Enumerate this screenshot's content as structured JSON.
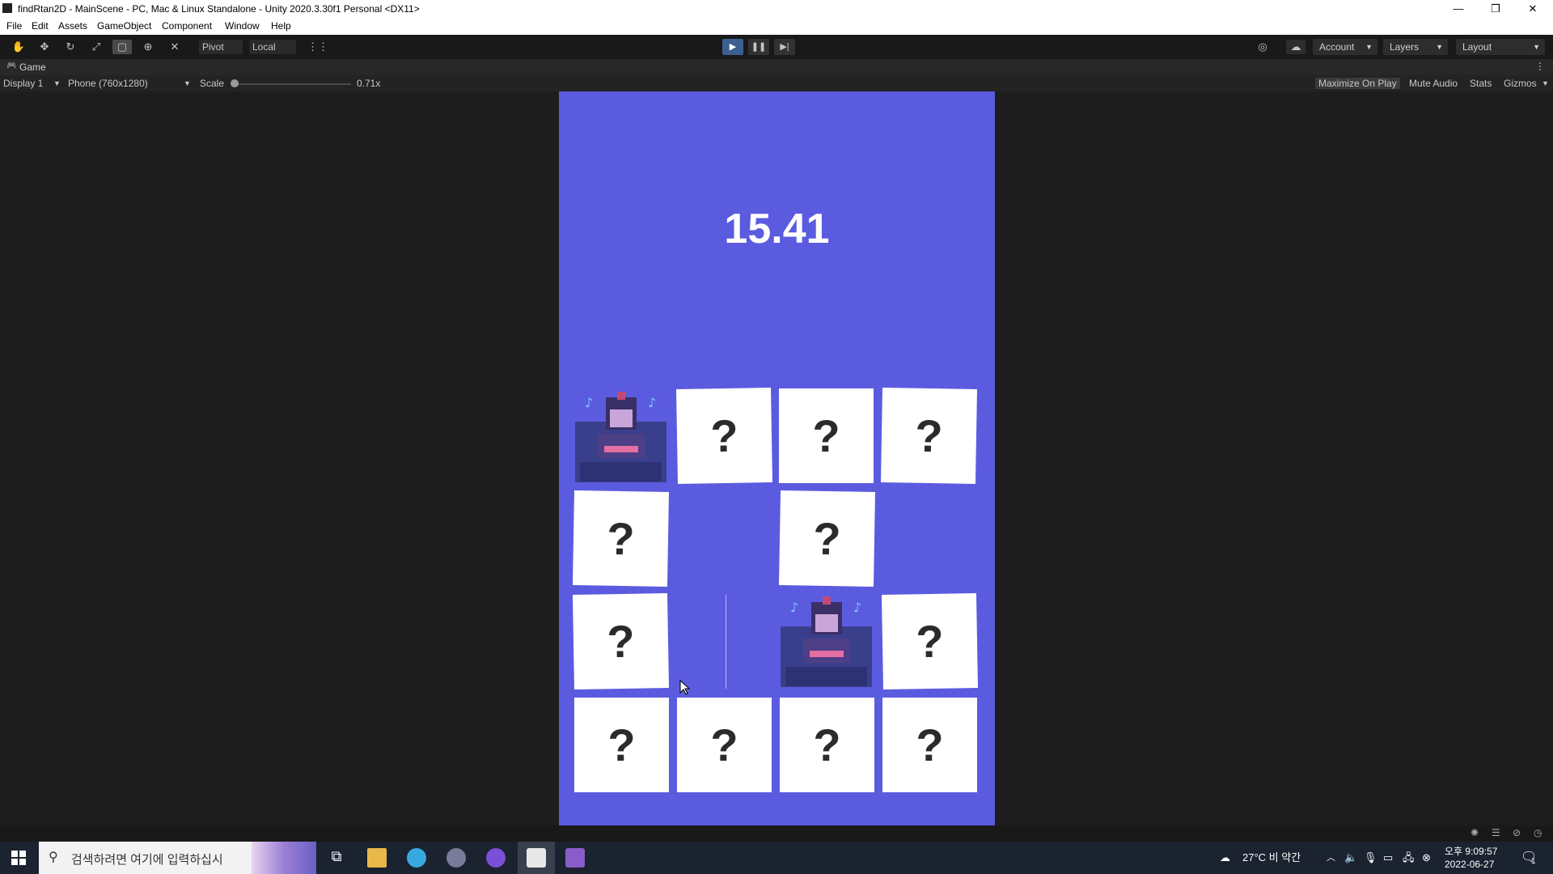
{
  "window": {
    "title": "findRtan2D - MainScene - PC, Mac & Linux Standalone - Unity 2020.3.30f1 Personal <DX11>",
    "minimize": "—",
    "restore": "❐",
    "close": "✕"
  },
  "menu": [
    "File",
    "Edit",
    "Assets",
    "GameObject",
    "Component",
    "Window",
    "Help"
  ],
  "toolbar": {
    "pivot": "Pivot",
    "local": "Local",
    "account": "Account",
    "layers": "Layers",
    "layout": "Layout",
    "play": "▶",
    "pause": "❚❚",
    "step": "▶|"
  },
  "game_tab": {
    "label": "Game",
    "display": "Display 1",
    "resolution": "Phone (760x1280)",
    "scale_label": "Scale",
    "scale_value": 0.71,
    "scale_text": "0.71x",
    "maximize": "Maximize On Play",
    "mute": "Mute Audio",
    "stats": "Stats",
    "gizmos": "Gizmos"
  },
  "game": {
    "timer": "15.41",
    "card_symbol": "?",
    "rows": [
      [
        "revealed",
        "hidden",
        "hidden",
        "hidden"
      ],
      [
        "hidden",
        "empty",
        "hidden",
        "empty"
      ],
      [
        "hidden",
        "empty",
        "revealed",
        "hidden"
      ],
      [
        "hidden",
        "hidden",
        "hidden",
        "hidden"
      ]
    ]
  },
  "taskbar": {
    "search_placeholder": "검색하려면 여기에 입력하십시",
    "weather": "27°C 비 약간",
    "time": "오후 9:09:57",
    "date": "2022-06-27",
    "notification_count": "1"
  },
  "colors": {
    "game_bg": "#5b5be0",
    "editor_bg": "#1d1d1d",
    "accent_play": "#3b5f8f"
  }
}
